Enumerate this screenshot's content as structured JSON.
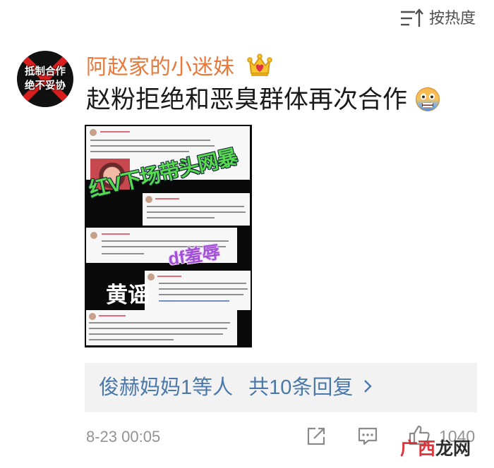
{
  "sort": {
    "label": "按热度",
    "icon": "sort-icon"
  },
  "comment": {
    "avatar": {
      "line1": "抵制合作",
      "line2": "绝不妥协"
    },
    "username": "阿赵家的小迷妹",
    "badge_icon": "crown-badge-icon",
    "text": "赵粉拒绝和恶臭群体再次合作",
    "emoji": "scared-face-emoji-icon",
    "image": {
      "overlay_green": "红V下场带头网暴",
      "overlay_purple": "df羞辱",
      "overlay_white": "黄谣"
    },
    "replies": {
      "users": "俊赫妈妈1等人",
      "count_label": "共10条回复",
      "chevron_icon": "chevron-right-icon"
    },
    "time": "8-23 00:05",
    "actions": {
      "share_icon": "share-icon",
      "comment_icon": "comment-icon",
      "like_icon": "like-icon",
      "like_count": "1040"
    }
  },
  "watermark": {
    "part1": "广西",
    "part2": "龙网"
  },
  "colors": {
    "username": "#e8793a",
    "link": "#4b78aa",
    "reply_bg": "#f2f2f2",
    "meta_gray": "#939393",
    "overlay_green": "#56d84f",
    "overlay_purple": "#a44fd8",
    "watermark_red": "#d8262e"
  }
}
